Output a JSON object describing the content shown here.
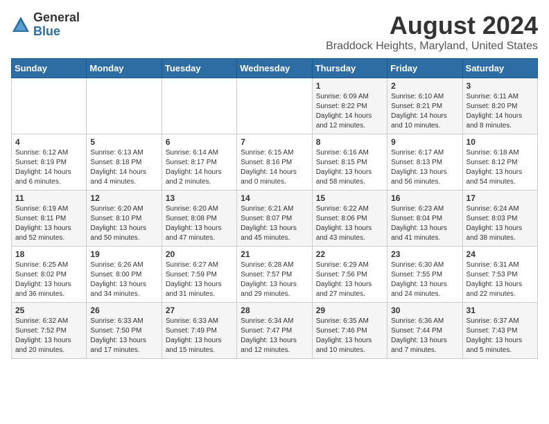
{
  "logo": {
    "general": "General",
    "blue": "Blue"
  },
  "title": "August 2024",
  "subtitle": "Braddock Heights, Maryland, United States",
  "days_of_week": [
    "Sunday",
    "Monday",
    "Tuesday",
    "Wednesday",
    "Thursday",
    "Friday",
    "Saturday"
  ],
  "weeks": [
    [
      {
        "day": "",
        "sunrise": "",
        "sunset": "",
        "daylight": ""
      },
      {
        "day": "",
        "sunrise": "",
        "sunset": "",
        "daylight": ""
      },
      {
        "day": "",
        "sunrise": "",
        "sunset": "",
        "daylight": ""
      },
      {
        "day": "",
        "sunrise": "",
        "sunset": "",
        "daylight": ""
      },
      {
        "day": "1",
        "sunrise": "Sunrise: 6:09 AM",
        "sunset": "Sunset: 8:22 PM",
        "daylight": "Daylight: 14 hours and 12 minutes."
      },
      {
        "day": "2",
        "sunrise": "Sunrise: 6:10 AM",
        "sunset": "Sunset: 8:21 PM",
        "daylight": "Daylight: 14 hours and 10 minutes."
      },
      {
        "day": "3",
        "sunrise": "Sunrise: 6:11 AM",
        "sunset": "Sunset: 8:20 PM",
        "daylight": "Daylight: 14 hours and 8 minutes."
      }
    ],
    [
      {
        "day": "4",
        "sunrise": "Sunrise: 6:12 AM",
        "sunset": "Sunset: 8:19 PM",
        "daylight": "Daylight: 14 hours and 6 minutes."
      },
      {
        "day": "5",
        "sunrise": "Sunrise: 6:13 AM",
        "sunset": "Sunset: 8:18 PM",
        "daylight": "Daylight: 14 hours and 4 minutes."
      },
      {
        "day": "6",
        "sunrise": "Sunrise: 6:14 AM",
        "sunset": "Sunset: 8:17 PM",
        "daylight": "Daylight: 14 hours and 2 minutes."
      },
      {
        "day": "7",
        "sunrise": "Sunrise: 6:15 AM",
        "sunset": "Sunset: 8:16 PM",
        "daylight": "Daylight: 14 hours and 0 minutes."
      },
      {
        "day": "8",
        "sunrise": "Sunrise: 6:16 AM",
        "sunset": "Sunset: 8:15 PM",
        "daylight": "Daylight: 13 hours and 58 minutes."
      },
      {
        "day": "9",
        "sunrise": "Sunrise: 6:17 AM",
        "sunset": "Sunset: 8:13 PM",
        "daylight": "Daylight: 13 hours and 56 minutes."
      },
      {
        "day": "10",
        "sunrise": "Sunrise: 6:18 AM",
        "sunset": "Sunset: 8:12 PM",
        "daylight": "Daylight: 13 hours and 54 minutes."
      }
    ],
    [
      {
        "day": "11",
        "sunrise": "Sunrise: 6:19 AM",
        "sunset": "Sunset: 8:11 PM",
        "daylight": "Daylight: 13 hours and 52 minutes."
      },
      {
        "day": "12",
        "sunrise": "Sunrise: 6:20 AM",
        "sunset": "Sunset: 8:10 PM",
        "daylight": "Daylight: 13 hours and 50 minutes."
      },
      {
        "day": "13",
        "sunrise": "Sunrise: 6:20 AM",
        "sunset": "Sunset: 8:08 PM",
        "daylight": "Daylight: 13 hours and 47 minutes."
      },
      {
        "day": "14",
        "sunrise": "Sunrise: 6:21 AM",
        "sunset": "Sunset: 8:07 PM",
        "daylight": "Daylight: 13 hours and 45 minutes."
      },
      {
        "day": "15",
        "sunrise": "Sunrise: 6:22 AM",
        "sunset": "Sunset: 8:06 PM",
        "daylight": "Daylight: 13 hours and 43 minutes."
      },
      {
        "day": "16",
        "sunrise": "Sunrise: 6:23 AM",
        "sunset": "Sunset: 8:04 PM",
        "daylight": "Daylight: 13 hours and 41 minutes."
      },
      {
        "day": "17",
        "sunrise": "Sunrise: 6:24 AM",
        "sunset": "Sunset: 8:03 PM",
        "daylight": "Daylight: 13 hours and 38 minutes."
      }
    ],
    [
      {
        "day": "18",
        "sunrise": "Sunrise: 6:25 AM",
        "sunset": "Sunset: 8:02 PM",
        "daylight": "Daylight: 13 hours and 36 minutes."
      },
      {
        "day": "19",
        "sunrise": "Sunrise: 6:26 AM",
        "sunset": "Sunset: 8:00 PM",
        "daylight": "Daylight: 13 hours and 34 minutes."
      },
      {
        "day": "20",
        "sunrise": "Sunrise: 6:27 AM",
        "sunset": "Sunset: 7:59 PM",
        "daylight": "Daylight: 13 hours and 31 minutes."
      },
      {
        "day": "21",
        "sunrise": "Sunrise: 6:28 AM",
        "sunset": "Sunset: 7:57 PM",
        "daylight": "Daylight: 13 hours and 29 minutes."
      },
      {
        "day": "22",
        "sunrise": "Sunrise: 6:29 AM",
        "sunset": "Sunset: 7:56 PM",
        "daylight": "Daylight: 13 hours and 27 minutes."
      },
      {
        "day": "23",
        "sunrise": "Sunrise: 6:30 AM",
        "sunset": "Sunset: 7:55 PM",
        "daylight": "Daylight: 13 hours and 24 minutes."
      },
      {
        "day": "24",
        "sunrise": "Sunrise: 6:31 AM",
        "sunset": "Sunset: 7:53 PM",
        "daylight": "Daylight: 13 hours and 22 minutes."
      }
    ],
    [
      {
        "day": "25",
        "sunrise": "Sunrise: 6:32 AM",
        "sunset": "Sunset: 7:52 PM",
        "daylight": "Daylight: 13 hours and 20 minutes."
      },
      {
        "day": "26",
        "sunrise": "Sunrise: 6:33 AM",
        "sunset": "Sunset: 7:50 PM",
        "daylight": "Daylight: 13 hours and 17 minutes."
      },
      {
        "day": "27",
        "sunrise": "Sunrise: 6:33 AM",
        "sunset": "Sunset: 7:49 PM",
        "daylight": "Daylight: 13 hours and 15 minutes."
      },
      {
        "day": "28",
        "sunrise": "Sunrise: 6:34 AM",
        "sunset": "Sunset: 7:47 PM",
        "daylight": "Daylight: 13 hours and 12 minutes."
      },
      {
        "day": "29",
        "sunrise": "Sunrise: 6:35 AM",
        "sunset": "Sunset: 7:46 PM",
        "daylight": "Daylight: 13 hours and 10 minutes."
      },
      {
        "day": "30",
        "sunrise": "Sunrise: 6:36 AM",
        "sunset": "Sunset: 7:44 PM",
        "daylight": "Daylight: 13 hours and 7 minutes."
      },
      {
        "day": "31",
        "sunrise": "Sunrise: 6:37 AM",
        "sunset": "Sunset: 7:43 PM",
        "daylight": "Daylight: 13 hours and 5 minutes."
      }
    ]
  ]
}
